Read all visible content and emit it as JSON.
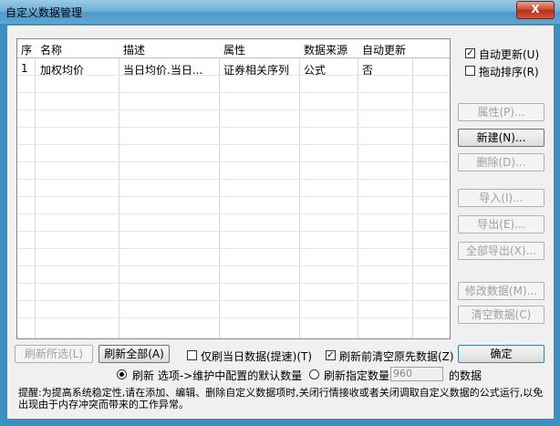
{
  "window": {
    "title": "自定义数据管理",
    "close_label": "X"
  },
  "grid": {
    "columns": [
      "序",
      "名称",
      "描述",
      "属性",
      "数据来源",
      "自动更新"
    ],
    "rows": [
      [
        "1",
        "加权均价",
        "当日均价.当日...",
        "证券相关序列",
        "公式",
        "否"
      ]
    ]
  },
  "options": {
    "auto_update": {
      "label": "自动更新(U)",
      "checked": true
    },
    "drag_sort": {
      "label": "拖动排序(R)",
      "checked": false
    }
  },
  "side_buttons": {
    "properties": "属性(P)...",
    "new": "新建(N)...",
    "delete": "删除(D)...",
    "import": "导入(I)...",
    "export": "导出(E)...",
    "export_all": "全部导出(X)...",
    "modify_data": "修改数据(M)...",
    "clear_data": "清空数据(C)"
  },
  "bottom": {
    "refresh_selected": "刷新所选(L)",
    "refresh_all": "刷新全部(A)",
    "today_only": {
      "label": "仅刷当日数据(提速)(T)",
      "checked": false
    },
    "clear_before_refresh": {
      "label": "刷新前清空原先数据(Z)",
      "checked": true
    },
    "ok": "确定",
    "refresh_default": "刷新 选项->维护中配置的默认数量",
    "refresh_specified": "刷新指定数量",
    "specified_value": "960",
    "data_suffix": "的数据",
    "notice": "提醒:为提高系统稳定性,请在添加、编辑、删除自定义数据项时,关闭行情接收或者关闭调取自定义数据的公式运行,以免出现由于内存冲突而带来的工作异常。"
  }
}
